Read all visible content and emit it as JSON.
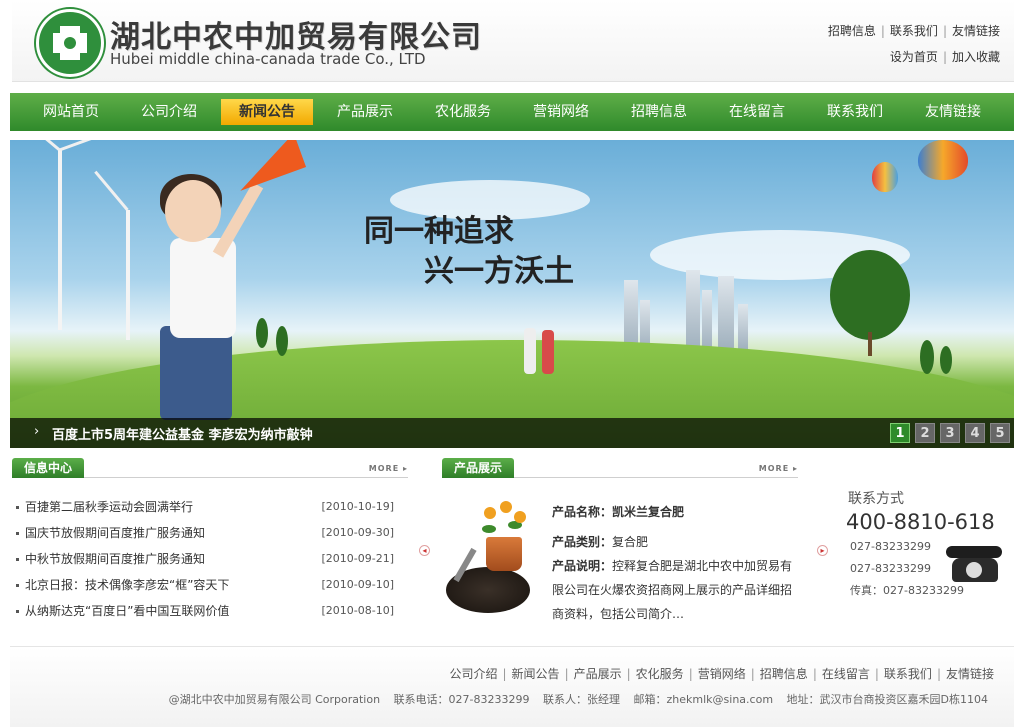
{
  "header": {
    "company_cn": "湖北中农中加贸易有限公司",
    "company_en": "Hubei middle china-canada trade Co., LTD",
    "top_links_row1": [
      "招聘信息",
      "联系我们",
      "友情链接"
    ],
    "top_links_row2": [
      "设为首页",
      "加入收藏"
    ]
  },
  "nav": {
    "items": [
      "网站首页",
      "公司介绍",
      "新闻公告",
      "产品展示",
      "农化服务",
      "营销网络",
      "招聘信息",
      "在线留言",
      "联系我们",
      "友情链接"
    ],
    "active": "新闻公告",
    "active_color": "#f5b400",
    "bar_color": "#3d922f"
  },
  "banner": {
    "slogan_line1": "同一种追求",
    "slogan_line2": "兴一方沃土",
    "caption": "百度上市5周年建公益基金  李彦宏为纳市敲钟",
    "pages": [
      "1",
      "2",
      "3",
      "4",
      "5"
    ],
    "active_page": "1"
  },
  "info_center": {
    "title": "信息中心",
    "more": "MORE",
    "news": [
      {
        "title": "百捷第二届秋季运动会圆满举行",
        "date": "[2010-10-19]"
      },
      {
        "title": "国庆节放假期间百度推广服务通知",
        "date": "[2010-09-30]"
      },
      {
        "title": "中秋节放假期间百度推广服务通知",
        "date": "[2010-09-21]"
      },
      {
        "title": "北京日报：技术偶像李彦宏“框”容天下",
        "date": "[2010-09-10]"
      },
      {
        "title": "从纳斯达克“百度日”看中国互联网价值",
        "date": "[2010-08-10]"
      }
    ]
  },
  "products": {
    "title": "产品展示",
    "more": "MORE",
    "name_label": "产品名称：",
    "name": "凯米兰复合肥",
    "type_label": "产品类别：",
    "type": "复合肥",
    "desc_label": "产品说明：",
    "desc": "控释复合肥是湖北中农中加贸易有限公司在火爆农资招商网上展示的产品详细招商资料，包括公司简介…"
  },
  "contact": {
    "title": "联系方式",
    "hotline": "400-8810-618",
    "phone1": "027-83233299",
    "phone2": "027-83233299",
    "fax": "传真：027-83233299"
  },
  "footer": {
    "links": [
      "公司介绍",
      "新闻公告",
      "产品展示",
      "农化服务",
      "营销网络",
      "招聘信息",
      "在线留言",
      "联系我们",
      "友情链接"
    ],
    "copyright": "@湖北中农中加贸易有限公司 Corporation",
    "phone": "联系电话：027-83233299",
    "contact_person": "联系人：张经理",
    "email": "邮箱：zhekmlk@sina.com",
    "address": "地址：武汉市台商投资区嘉禾园D栋1104"
  }
}
